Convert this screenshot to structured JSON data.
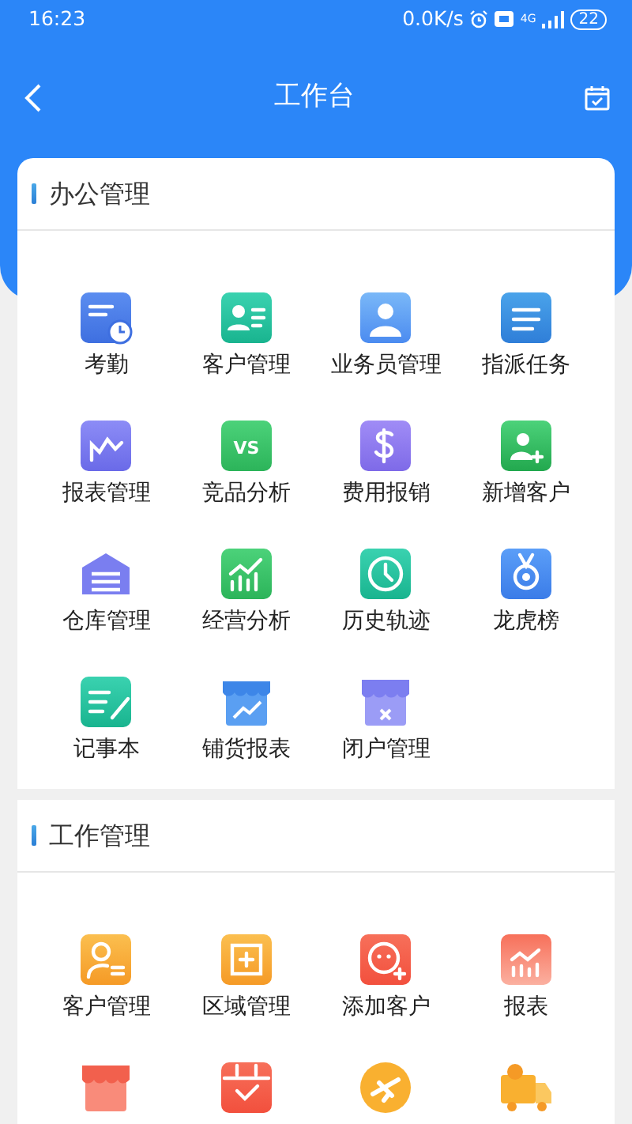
{
  "status_bar": {
    "time": "16:23",
    "speed": "0.0K/s",
    "network": "4G",
    "battery": "22"
  },
  "header": {
    "title": "工作台"
  },
  "sections": [
    {
      "title": "办公管理",
      "items": [
        {
          "kind": "labeled",
          "label": "考勤"
        },
        {
          "kind": "labeled",
          "label": "客户管理"
        },
        {
          "kind": "labeled",
          "label": "业务员管理"
        },
        {
          "kind": "labeled",
          "label": "指派任务"
        },
        {
          "kind": "labeled",
          "label": "报表管理"
        },
        {
          "kind": "labeled",
          "label": "竞品分析",
          "icon_text": "VS"
        },
        {
          "kind": "labeled",
          "label": "费用报销"
        },
        {
          "kind": "labeled",
          "label": "新增客户"
        },
        {
          "kind": "labeled",
          "label": "仓库管理"
        },
        {
          "kind": "labeled",
          "label": "经营分析"
        },
        {
          "kind": "labeled",
          "label": "历史轨迹"
        },
        {
          "kind": "labeled",
          "label": "龙虎榜"
        },
        {
          "kind": "labeled",
          "label": "记事本"
        },
        {
          "kind": "labeled",
          "label": "铺货报表"
        },
        {
          "kind": "labeled",
          "label": "闭户管理"
        }
      ]
    },
    {
      "title": "工作管理",
      "items": [
        {
          "kind": "labeled",
          "label": "客户管理"
        },
        {
          "kind": "labeled",
          "label": "区域管理"
        },
        {
          "kind": "labeled",
          "label": "添加客户"
        },
        {
          "kind": "labeled",
          "label": "报表"
        },
        {
          "kind": "icon-only"
        },
        {
          "kind": "icon-only"
        },
        {
          "kind": "icon-only"
        },
        {
          "kind": "icon-only"
        }
      ]
    }
  ]
}
